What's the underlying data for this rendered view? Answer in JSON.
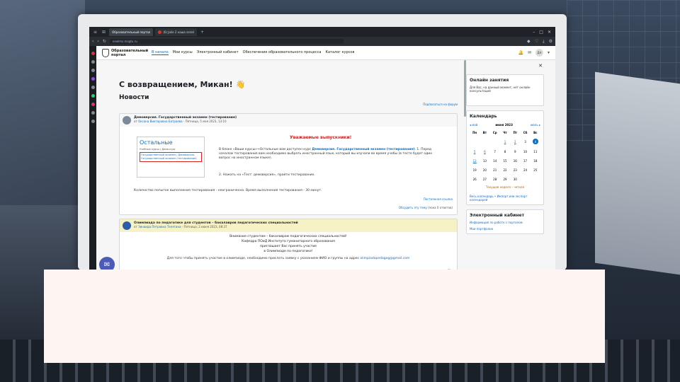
{
  "browser": {
    "tabs": [
      "Образовательный портал",
      "(6) Jolie 2 наша seriel"
    ],
    "url": "newlms.magtu.ru"
  },
  "site": {
    "logo_text": [
      "Образовательный",
      "портал"
    ],
    "nav": [
      "В начало",
      "Мои курсы",
      "Электронный кабинет",
      "Обеспечение образовательного процесса",
      "Каталог курсов"
    ],
    "user_initials": "ДН"
  },
  "main": {
    "welcome": "С возвращением, Микан! 👋",
    "news_heading": "Новости",
    "subscribe_link": "Подписаться на форум",
    "post1": {
      "title": "Демоверсия. Государственный экзамен (тестирование)",
      "meta_prefix": "от",
      "author": "Оксана Викторовна Батраева",
      "date": "- Пятница, 5 мая 2023, 13:10",
      "card_title": "Остальные",
      "card_crumbs": "Учебные курсы / Демо-курс",
      "card_highlight": "Государственный экзамен / Демоверсия. Государственный экзамен (тестирование)",
      "attention": "Уважаемые выпускники!",
      "paragraph_start": "В блоке «Ваши курсы»→Остальные вам доступен курс",
      "paragraph_link": "Демоверсия. Государственный экзамен (тестирование)",
      "paragraph_end": ". 1. Перед началом тестирования вам необходимо выбрать иностранный язык, который вы изучали во время учебы (в тесте будет один вопрос на иностранном языке).",
      "step2": "2. Нажать на «Тест: демоверсия», пройти тестирование.",
      "attempts": "Количество попыток выполнения тестирования - неограниченно. Время выполнения тестирования - 30 минут.",
      "permalink": "Постоянная ссылка",
      "discuss_link": "Обсудить эту тему",
      "discuss_count": "(пока 0 ответов)"
    },
    "post2": {
      "title": "Олимпиада по педагогике для студентов – бакалавров педагогических специальностей",
      "meta_prefix": "от",
      "author": "Зинаида Петровна Телегина",
      "date": "- Пятница, 2 июня 2023, 08:37",
      "lines": [
        "Внимание студентам – бакалаврам педагогических специальностей!",
        "Кафедра ПОиД Института гуманитарного образования",
        "приглашает Вас принять участие",
        "в Олимпиаде по педагогике!"
      ],
      "bottom_text": "Для того чтобы принять участие в олимпиаде, необходимо прислать заявку с указанием ФИО и группы на адрес",
      "email": "olimpiadapedagog@gmail.com"
    }
  },
  "right": {
    "online": {
      "title": "Онлайн занятия",
      "text": "Для Вас, на данный момент, нет онлайн консультаций"
    },
    "calendar": {
      "title": "Календарь",
      "prev": "◂ май",
      "month": "июня 2023",
      "next": "июль ▸",
      "day_headers": [
        "Пн",
        "Вт",
        "Ср",
        "Чт",
        "Пт",
        "Сб",
        "Вс"
      ],
      "week_label": "Текущая неделя – четная",
      "links": [
        "Весь календарь",
        "Импорт или экспорт календарей"
      ]
    },
    "cabinet": {
      "title": "Электронный кабинет",
      "links": [
        "Информация по работе с порталом",
        "Мои портфолио"
      ]
    }
  },
  "colors": {
    "accent": "#0f6cbf",
    "alert": "#dd2222",
    "mail_button": "#4d5bb8"
  }
}
